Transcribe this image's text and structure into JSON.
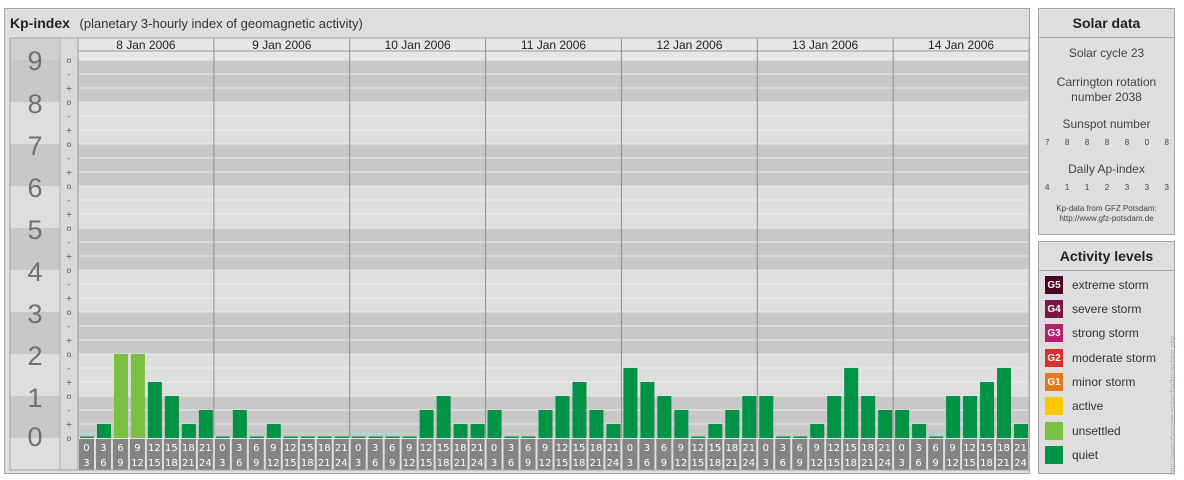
{
  "header": {
    "title": "Kp-index",
    "subtitle": "(planetary 3-hourly index of geomagnetic activity)"
  },
  "chart_data": {
    "type": "bar",
    "title": "Kp-index",
    "subtitle": "(planetary 3-hourly index of geomagnetic activity)",
    "ylim": [
      0,
      9
    ],
    "y_tick_labels": [
      "0",
      "1",
      "2",
      "3",
      "4",
      "5",
      "6",
      "7",
      "8",
      "9"
    ],
    "minor_tick_labels": [
      "o",
      "+",
      "-"
    ],
    "days": [
      "8 Jan 2006",
      "9 Jan 2006",
      "10 Jan 2006",
      "11 Jan 2006",
      "12 Jan 2006",
      "13 Jan 2006",
      "14 Jan 2006"
    ],
    "hour_labels_top": [
      "0",
      "3",
      "6",
      "9",
      "12",
      "15",
      "18",
      "21"
    ],
    "hour_labels_bottom": [
      "3",
      "6",
      "9",
      "12",
      "15",
      "18",
      "21",
      "24"
    ],
    "values": [
      [
        0.333,
        2.0,
        2.0,
        1.333,
        1.0,
        0.333,
        0.667
      ],
      [
        0.0,
        0.667,
        0.0,
        0.333,
        0.0,
        0.0,
        0.0,
        0.0
      ],
      [
        0.0,
        0.0,
        0.0,
        0.0,
        0.667,
        1.0,
        0.333,
        0.333
      ],
      [
        0.667,
        0.0,
        0.0,
        0.667,
        1.0,
        1.333,
        0.667,
        0.333
      ],
      [
        1.667,
        1.333,
        1.0,
        0.667,
        0.0,
        0.333,
        0.667,
        1.0
      ],
      [
        1.0,
        0.0,
        0.0,
        0.333,
        1.0,
        1.667,
        1.0,
        0.667
      ],
      [
        0.667,
        0.333,
        0.0,
        1.0,
        1.0,
        1.333,
        1.667,
        0.333
      ]
    ],
    "first_day_values_start_index": 1,
    "first_day_first_value": 0.0,
    "colors": {
      "quiet": "#009245",
      "unsettled": "#7ac143",
      "active": "#fcc600",
      "band_dark": "#c8c8c8",
      "band_light": "#dedede",
      "axis_bg": "#848484"
    }
  },
  "solar": {
    "heading": "Solar data",
    "cycle": "Solar cycle 23",
    "carrington": "Carrington rotation number 2038",
    "sunspot_label": "Sunspot number",
    "sunspot_values": [
      "7",
      "8",
      "8",
      "8",
      "8",
      "0",
      "8"
    ],
    "ap_label": "Daily Ap-index",
    "ap_values": [
      "4",
      "1",
      "1",
      "2",
      "3",
      "3",
      "3"
    ],
    "source_line1": "Kp-data from GFZ Potsdam:",
    "source_line2": "http://www.gfz-potsdam.de"
  },
  "levels": {
    "heading": "Activity levels",
    "items": [
      {
        "code": "G5",
        "label": "extreme storm",
        "color": "#4d0026"
      },
      {
        "code": "G4",
        "label": "severe storm",
        "color": "#7a1646"
      },
      {
        "code": "G3",
        "label": "strong storm",
        "color": "#b3206e"
      },
      {
        "code": "G2",
        "label": "moderate storm",
        "color": "#d9302b"
      },
      {
        "code": "G1",
        "label": "minor storm",
        "color": "#e8781e"
      },
      {
        "code": "",
        "label": "active",
        "color": "#fcc600"
      },
      {
        "code": "",
        "label": "unsettled",
        "color": "#7ac143"
      },
      {
        "code": "",
        "label": "quiet",
        "color": "#009245"
      }
    ]
  },
  "watermark": "http://www.theusner.eu/archiv/kp-archive.php"
}
